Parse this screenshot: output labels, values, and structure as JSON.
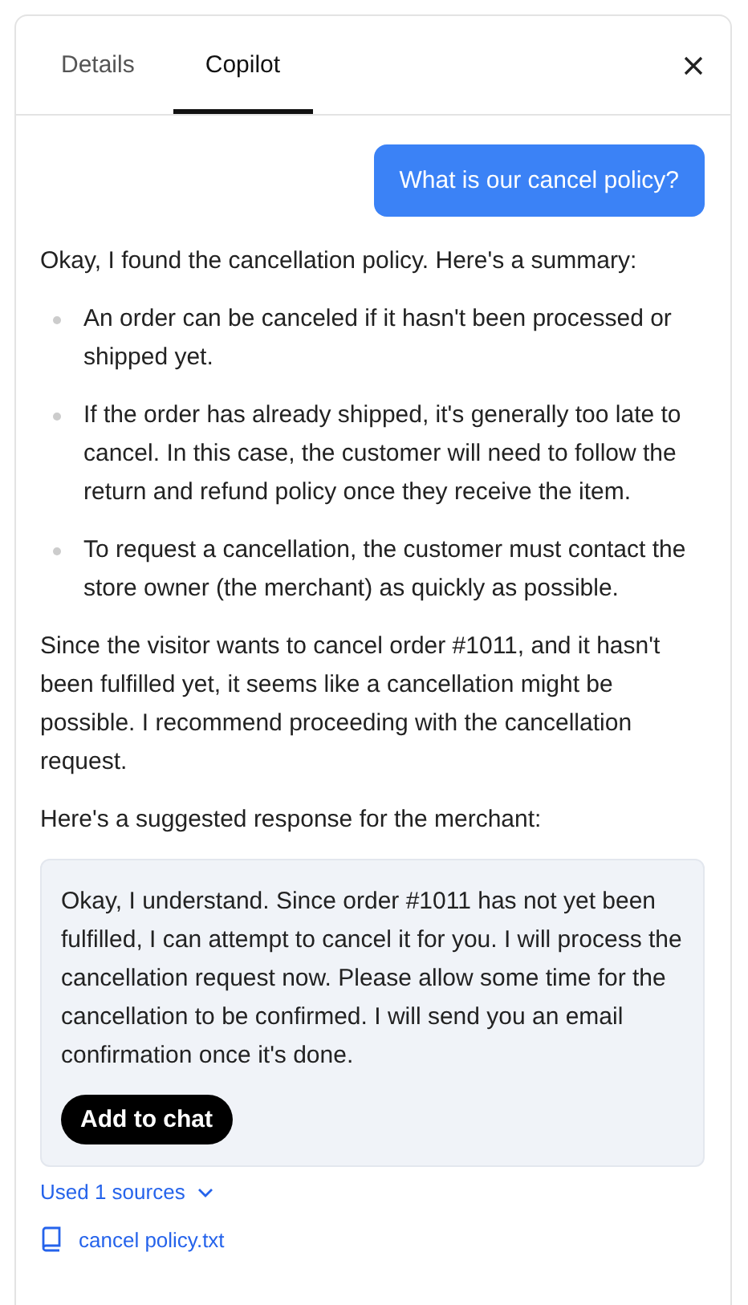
{
  "tabs": [
    {
      "label": "Details",
      "selected": false
    },
    {
      "label": "Copilot",
      "selected": true
    }
  ],
  "user_message": "What is our cancel policy?",
  "reply": {
    "intro": "Okay, I found the cancellation policy. Here's a summary:",
    "bullets": [
      "An order can be canceled if it hasn't been processed or shipped yet.",
      "If the order has already shipped, it's generally too late to cancel. In this case, the customer will need to follow the return and refund policy once they receive the item.",
      "To request a cancellation, the customer must contact the store owner (the merchant) as quickly as possible."
    ],
    "paragraphs": [
      "Since the visitor wants to cancel order #1011, and it hasn't been fulfilled yet, it seems like a cancellation might be possible. I recommend proceeding with the cancellation request.",
      "Here's a suggested response for the merchant:"
    ],
    "suggestion": {
      "text": "Okay, I understand. Since order #1011 has not yet been fulfilled, I can attempt to cancel it for you. I will process the cancellation request now. Please allow some time for the cancellation to be confirmed. I will send you an email confirmation once it's done.",
      "button": "Add to chat"
    }
  },
  "sources": {
    "label": "Used 1 sources",
    "files": [
      "cancel policy.txt"
    ]
  }
}
